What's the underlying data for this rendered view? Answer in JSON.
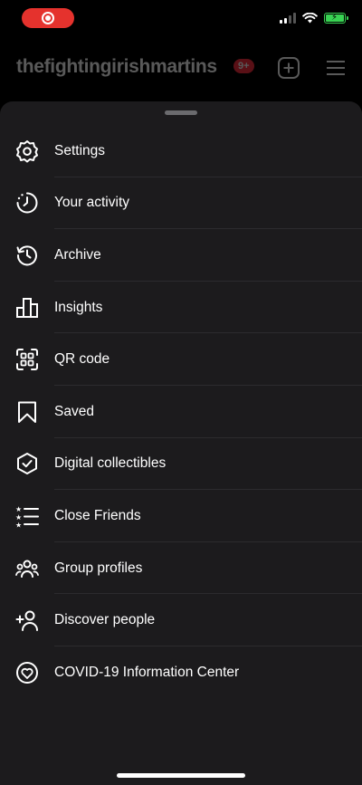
{
  "header": {
    "username": "thefightingirishmartins",
    "notification_badge": "9+"
  },
  "menu": {
    "items": [
      {
        "label": "Settings",
        "icon": "settings-gear-icon"
      },
      {
        "label": "Your activity",
        "icon": "activity-clock-icon"
      },
      {
        "label": "Archive",
        "icon": "archive-history-icon"
      },
      {
        "label": "Insights",
        "icon": "insights-bar-chart-icon"
      },
      {
        "label": "QR code",
        "icon": "qr-code-icon"
      },
      {
        "label": "Saved",
        "icon": "bookmark-icon"
      },
      {
        "label": "Digital collectibles",
        "icon": "collectible-hexagon-check-icon"
      },
      {
        "label": "Close Friends",
        "icon": "close-friends-star-list-icon"
      },
      {
        "label": "Group profiles",
        "icon": "group-people-icon"
      },
      {
        "label": "Discover people",
        "icon": "add-person-icon"
      },
      {
        "label": "COVID-19 Information Center",
        "icon": "covid-heart-icon"
      }
    ]
  },
  "colors": {
    "background": "#000000",
    "sheet": "#1c1b1d",
    "recording_pill": "#e5322d",
    "battery": "#39d353"
  }
}
